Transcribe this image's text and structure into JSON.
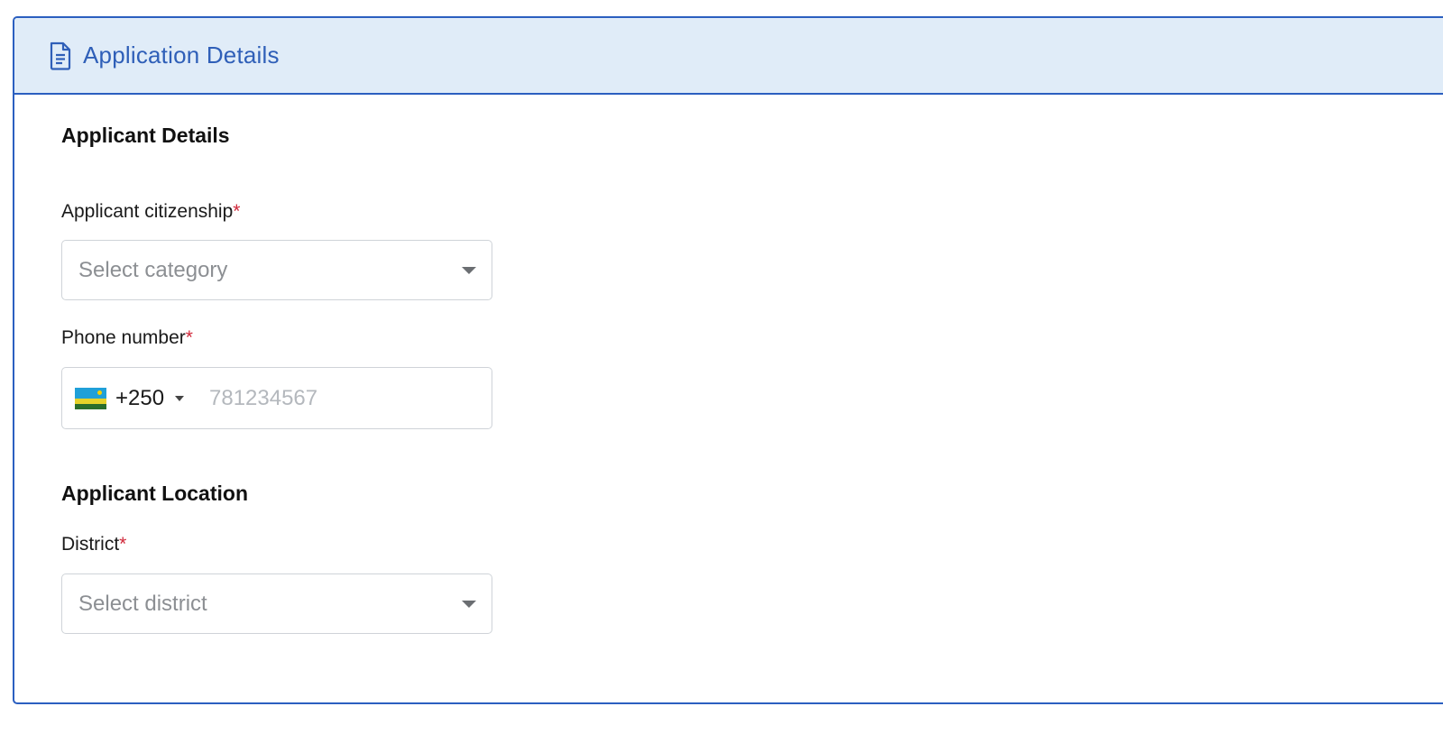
{
  "header": {
    "title": "Application Details",
    "icon": "document-icon"
  },
  "applicant_details": {
    "heading": "Applicant Details",
    "citizenship": {
      "label": "Applicant citizenship",
      "required_mark": "*",
      "placeholder": "Select category"
    },
    "phone": {
      "label": "Phone number",
      "required_mark": "*",
      "country_flag": "rwanda-flag-icon",
      "dial_code": "+250",
      "placeholder": "781234567",
      "value": ""
    }
  },
  "applicant_location": {
    "heading": "Applicant Location",
    "district": {
      "label": "District",
      "required_mark": "*",
      "placeholder": "Select district"
    }
  },
  "colors": {
    "accent": "#2b5fc0",
    "header_bg": "#e0ecf8",
    "required": "#d0283a"
  }
}
